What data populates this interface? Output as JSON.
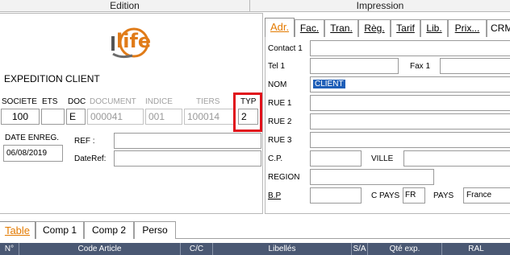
{
  "headers": {
    "edition": "Edition",
    "impression": "Impression"
  },
  "logo": {
    "text": "life",
    "brand_color": "#e07b18"
  },
  "form": {
    "title": "EXPEDITION CLIENT",
    "labels": {
      "societe": "SOCIETE",
      "ets": "ETS",
      "doc": "DOC",
      "document": "DOCUMENT",
      "indice": "INDICE",
      "tiers": "TIERS",
      "typ": "TYP"
    },
    "values": {
      "societe": "100",
      "ets": "",
      "doc": "E",
      "document": "000041",
      "indice": "001",
      "tiers": "100014",
      "typ": "2"
    },
    "date_enreg_label": "DATE ENREG.",
    "date_enreg_value": "06/08/2019",
    "ref_label": "REF :",
    "ref_value": "",
    "dateref_label": "DateRef:",
    "dateref_value": ""
  },
  "right_tabs": [
    {
      "label": "Adr."
    },
    {
      "label": "Fac."
    },
    {
      "label": "Tran."
    },
    {
      "label": "Règ."
    },
    {
      "label": "Tarif"
    },
    {
      "label": "Lib."
    },
    {
      "label": "Prix..."
    },
    {
      "label": "CRM"
    }
  ],
  "address": {
    "contact1_label": "Contact 1",
    "contact1_value": "",
    "tel1_label": "Tel 1",
    "tel1_value": "",
    "fax1_label": "Fax 1",
    "fax1_value": "",
    "nom_label": "NOM",
    "nom_value": "CLIENT",
    "rue1_label": "RUE 1",
    "rue2_label": "RUE 2",
    "rue3_label": "RUE 3",
    "cp_label": "C.P.",
    "ville_label": "VILLE",
    "region_label": "REGION",
    "bp_label": "B.P",
    "cpays_label": "C PAYS",
    "cpays_value": "FR",
    "pays_label": "PAYS",
    "pays_value": "France"
  },
  "bottom_tabs": [
    {
      "label": "Table"
    },
    {
      "label": "Comp 1"
    },
    {
      "label": "Comp 2"
    },
    {
      "label": "Perso"
    }
  ],
  "table_headers": [
    "N°",
    "Code Article",
    "C/C",
    "Libellés",
    "S/A",
    "Qté exp.",
    "RAL"
  ],
  "colors": {
    "active_tab": "#e37a00",
    "highlight": "#e0101a",
    "table_header_bg": "#4a5873",
    "selection": "#1f5fb8"
  }
}
